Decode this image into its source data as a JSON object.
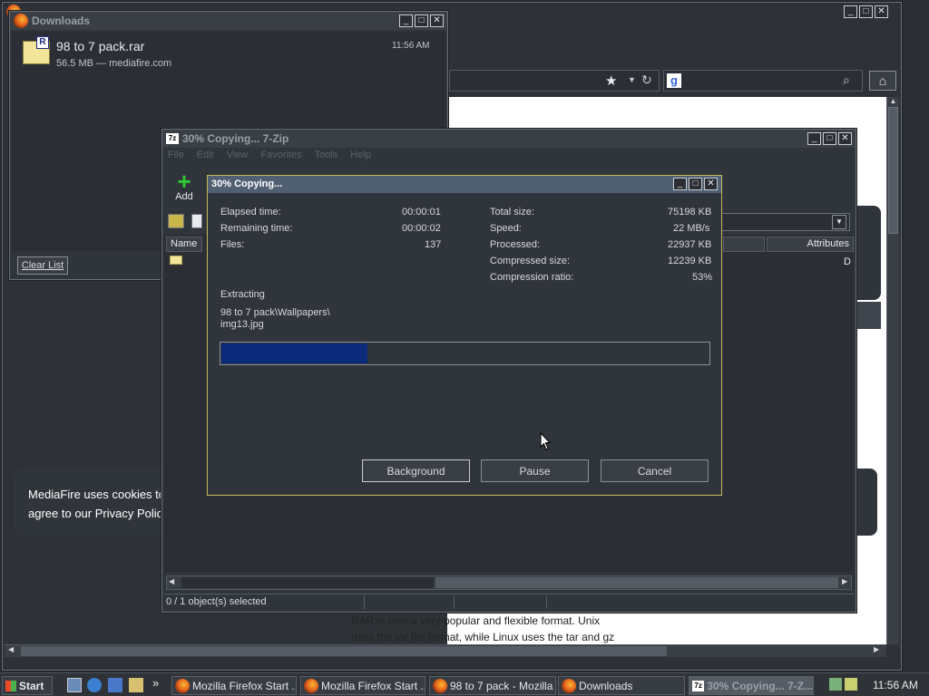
{
  "browser": {
    "title": "Mozilla Firefox Start",
    "cookie_text_line1": "MediaFire uses cookies to",
    "cookie_text_line2": "agree to our Privacy Polic",
    "body_text_line1": "RAR is also a very popular and flexible format. Unix",
    "body_text_line2": "uses the tar file format, while Linux uses the tar and gz"
  },
  "downloads": {
    "title": "Downloads",
    "item_name": "98 to 7 pack.rar",
    "item_detail": "56.5 MB — mediafire.com",
    "item_time": "11:56 AM",
    "clear_label": "Clear List"
  },
  "zip": {
    "title": "30% Copying... 7-Zip",
    "menu": [
      "File",
      "Edit",
      "View",
      "Favorites",
      "Tools",
      "Help"
    ],
    "add_label": "Add",
    "col_name": "Name",
    "col_attributes": "Attributes",
    "attr_value": "D",
    "status": "0 / 1 object(s) selected"
  },
  "progress": {
    "title": "30% Copying...",
    "elapsed_label": "Elapsed time:",
    "elapsed_value": "00:00:01",
    "remaining_label": "Remaining time:",
    "remaining_value": "00:00:02",
    "files_label": "Files:",
    "files_value": "137",
    "total_label": "Total size:",
    "total_value": "75198 KB",
    "speed_label": "Speed:",
    "speed_value": "22 MB/s",
    "processed_label": "Processed:",
    "processed_value": "22937 KB",
    "compressed_label": "Compressed size:",
    "compressed_value": "12239 KB",
    "ratio_label": "Compression ratio:",
    "ratio_value": "53%",
    "action": "Extracting",
    "path_line1": "98 to 7 pack\\Wallpapers\\",
    "path_line2": "img13.jpg",
    "fraction": 0.3,
    "bar_color": "#0b2a7a",
    "background_label": "Background",
    "pause_label": "Pause",
    "cancel_label": "Cancel"
  },
  "taskbar": {
    "start_label": "Start",
    "items": [
      "Mozilla Firefox Start ...",
      "Mozilla Firefox Start ...",
      "98 to 7 pack - Mozilla ...",
      "Downloads",
      "30% Copying... 7-Z..."
    ],
    "clock": "11:56 AM"
  }
}
